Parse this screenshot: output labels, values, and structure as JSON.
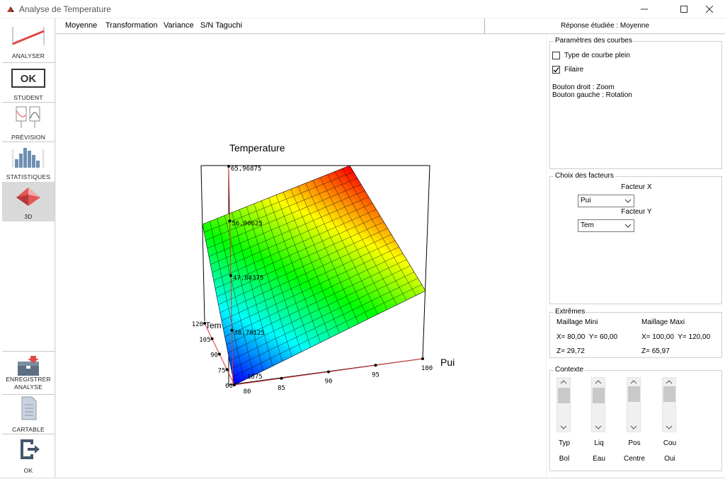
{
  "window": {
    "title": "Analyse de Temperature"
  },
  "sidebar": {
    "items": [
      {
        "label": "ANALYSER",
        "icon": "analyser-icon"
      },
      {
        "label": "STUDENT",
        "icon": "ok-box-icon",
        "badge": "OK"
      },
      {
        "label": "PRÉVISION",
        "icon": "prevision-icon"
      },
      {
        "label": "STATISTIQUES",
        "icon": "statistics-icon"
      },
      {
        "label": "3D",
        "icon": "3d-surface-icon"
      }
    ],
    "bottom_items": [
      {
        "label1": "ENREGISTRER",
        "label2": "ANALYSE",
        "icon": "save-analysis-icon"
      },
      {
        "label": "CARTABLE",
        "icon": "document-icon"
      },
      {
        "label": "OK",
        "icon": "exit-icon"
      }
    ]
  },
  "menu": {
    "items": [
      "Moyenne",
      "Transformation",
      "Variance",
      "S/N Taguchi"
    ]
  },
  "response_label": "Réponse étudiée : Moyenne",
  "chart": {
    "title": "Temperature",
    "x_axis_label": "Pui",
    "y_axis_label": "Tem",
    "x_ticks": [
      "80",
      "85",
      "90",
      "95",
      "100"
    ],
    "y_ticks": [
      "60",
      "75",
      "90",
      "105",
      "120"
    ],
    "z_ticks": [
      "65,96875",
      "56,90625",
      "47,84375",
      "38,78125",
      "29,71875"
    ],
    "z_tick_partial_label": "1875"
  },
  "chart_data": {
    "type": "surface",
    "title": "Temperature",
    "x_label": "Pui",
    "y_label": "Tem",
    "x_range": [
      80,
      100
    ],
    "y_range": [
      60,
      120
    ],
    "z_range": [
      29.71875,
      65.96875
    ],
    "x_ticks": [
      80,
      85,
      90,
      95,
      100
    ],
    "y_ticks": [
      60,
      75,
      90,
      105,
      120
    ],
    "z_ticks": [
      65.96875,
      56.90625,
      47.84375,
      38.78125,
      29.71875
    ],
    "colormap": [
      "#0000ff",
      "#00ffff",
      "#00ff00",
      "#ffff00",
      "#ff0000"
    ]
  },
  "params": {
    "legend": "Paramètres des courbes",
    "filled_label": "Type de courbe plein",
    "filled_checked": false,
    "wire_label": "Filaire",
    "wire_checked": true,
    "hint1": "Bouton droit : Zoom",
    "hint2": "Bouton gauche : Rotation"
  },
  "factors": {
    "legend": "Choix des facteurs",
    "x_label": "Facteur X",
    "x_value": "Pui",
    "y_label": "Facteur Y",
    "y_value": "Tem"
  },
  "extremes": {
    "legend": "Extrêmes",
    "min_title": "Maillage Mini",
    "max_title": "Maillage Maxi",
    "min_xy": "X= 80,00  Y= 60,00",
    "min_z": "Z= 29,72",
    "max_xy": "X= 100,00  Y= 120,00",
    "max_z": "Z= 65,97"
  },
  "context": {
    "legend": "Contexte",
    "sliders": [
      {
        "top": "Typ",
        "bottom": "Bol"
      },
      {
        "top": "Liq",
        "bottom": "Eau"
      },
      {
        "top": "Pos",
        "bottom": "Centre"
      },
      {
        "top": "Cou",
        "bottom": "Oui"
      }
    ]
  }
}
